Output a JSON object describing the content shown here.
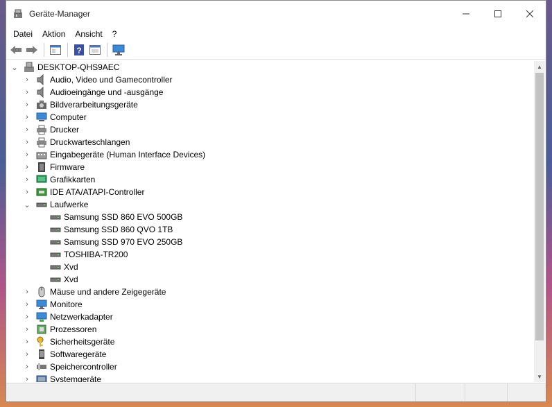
{
  "window": {
    "title": "Geräte-Manager"
  },
  "menu": [
    "Datei",
    "Aktion",
    "Ansicht",
    "?"
  ],
  "toolbar": [
    "back-icon",
    "forward-icon",
    "properties-icon",
    "help-icon",
    "details-icon",
    "monitor-scan-icon"
  ],
  "tree": {
    "root": "DESKTOP-QHS9AEC",
    "categories": [
      {
        "label": "Audio, Video und Gamecontroller",
        "icon": "speaker-icon"
      },
      {
        "label": "Audioeingänge und -ausgänge",
        "icon": "speaker-icon"
      },
      {
        "label": "Bildverarbeitungsgeräte",
        "icon": "camera-icon"
      },
      {
        "label": "Computer",
        "icon": "computer-icon"
      },
      {
        "label": "Drucker",
        "icon": "printer-icon"
      },
      {
        "label": "Druckwarteschlangen",
        "icon": "printer-icon"
      },
      {
        "label": "Eingabegeräte (Human Interface Devices)",
        "icon": "hid-icon"
      },
      {
        "label": "Firmware",
        "icon": "chip-icon"
      },
      {
        "label": "Grafikkarten",
        "icon": "display-adapter-icon"
      },
      {
        "label": "IDE ATA/ATAPI-Controller",
        "icon": "controller-icon"
      },
      {
        "label": "Laufwerke",
        "icon": "drive-icon",
        "expanded": true,
        "children": [
          "Samsung SSD 860 EVO 500GB",
          "Samsung SSD 860 QVO 1TB",
          "Samsung SSD 970 EVO 250GB",
          "TOSHIBA-TR200",
          "Xvd",
          "Xvd"
        ]
      },
      {
        "label": "Mäuse und andere Zeigegeräte",
        "icon": "mouse-icon"
      },
      {
        "label": "Monitore",
        "icon": "monitor-icon"
      },
      {
        "label": "Netzwerkadapter",
        "icon": "network-icon"
      },
      {
        "label": "Prozessoren",
        "icon": "cpu-icon"
      },
      {
        "label": "Sicherheitsgeräte",
        "icon": "key-icon"
      },
      {
        "label": "Softwaregeräte",
        "icon": "software-device-icon"
      },
      {
        "label": "Speichercontroller",
        "icon": "storage-controller-icon"
      },
      {
        "label": "Systemgeräte",
        "icon": "system-device-icon"
      }
    ]
  }
}
